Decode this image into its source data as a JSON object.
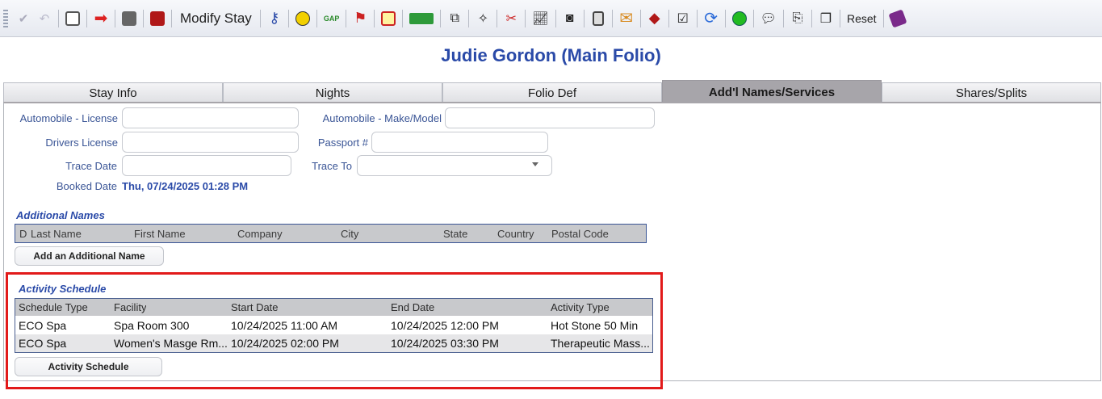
{
  "toolbar": {
    "modify_stay": "Modify Stay",
    "reset": "Reset",
    "icons": [
      "check-icon",
      "undo-icon",
      "notes-icon",
      "checkout-icon",
      "print-icon",
      "book-icon",
      "key-icon",
      "smiley-coin-icon",
      "gap-icon",
      "people-icon",
      "cancel-doc-icon",
      "money-icon",
      "copy-icon",
      "wand-icon",
      "nrl-icon",
      "chart-icon",
      "camera-icon",
      "calculator-icon",
      "mail-icon",
      "eraser-icon",
      "clipboard-icon",
      "refresh-icon",
      "happy-face-icon",
      "speech-icon",
      "scroll-icon",
      "copy-doc-icon",
      "book-purple-icon"
    ]
  },
  "title": "Judie Gordon (Main Folio)",
  "tabs": [
    "Stay Info",
    "Nights",
    "Folio Def",
    "Add'l Names/Services",
    "Shares/Splits"
  ],
  "active_tab": 3,
  "form": {
    "auto_license_label": "Automobile - License",
    "auto_make_label": "Automobile - Make/Model",
    "drivers_license_label": "Drivers License",
    "passport_label": "Passport #",
    "trace_date_label": "Trace Date",
    "trace_to_label": "Trace To",
    "booked_date_label": "Booked Date",
    "booked_date_value": "Thu, 07/24/2025 01:28 PM"
  },
  "additional_names": {
    "title": "Additional Names",
    "columns": [
      "D",
      "Last Name",
      "First Name",
      "Company",
      "City",
      "State",
      "Country",
      "Postal Code"
    ],
    "button": "Add an Additional Name"
  },
  "activity_schedule": {
    "title": "Activity Schedule",
    "columns": [
      "Schedule Type",
      "Facility",
      "Start Date",
      "End Date",
      "Activity Type"
    ],
    "rows": [
      [
        "ECO Spa",
        "Spa Room 300",
        "10/24/2025 11:00 AM",
        "10/24/2025 12:00 PM",
        "Hot Stone 50 Min"
      ],
      [
        "ECO Spa",
        "Women's Masge Rm...",
        "10/24/2025 02:00 PM",
        "10/24/2025 03:30 PM",
        "Therapeutic Mass..."
      ]
    ],
    "button": "Activity Schedule"
  },
  "colors": {
    "accent": "#2a4aa8",
    "highlight": "#e21a1a",
    "active_tab": "#a7a5aa"
  }
}
